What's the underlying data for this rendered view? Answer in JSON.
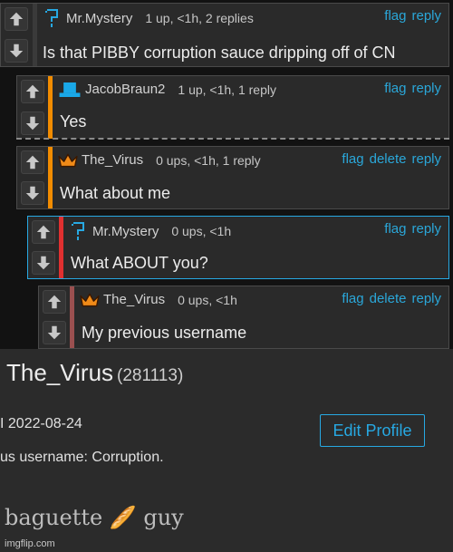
{
  "comments": [
    {
      "username": "Mr.Mystery",
      "meta": "1 up, <1h, 2 replies",
      "text": "Is that PIBBY corruption sauce dripping off of CN",
      "actions": [
        "flag",
        "reply"
      ]
    },
    {
      "username": "JacobBraun2",
      "meta": "1 up, <1h, 1 reply",
      "text": "Yes",
      "actions": [
        "flag",
        "reply"
      ]
    },
    {
      "username": "The_Virus",
      "meta": "0 ups, <1h, 1 reply",
      "text": "What about me",
      "actions": [
        "flag",
        "delete",
        "reply"
      ]
    },
    {
      "username": "Mr.Mystery",
      "meta": "0 ups, <1h",
      "text": "What ABOUT you?",
      "actions": [
        "flag",
        "reply"
      ]
    },
    {
      "username": "The_Virus",
      "meta": "0 ups, <1h",
      "text": "My previous username",
      "actions": [
        "flag",
        "delete",
        "reply"
      ]
    }
  ],
  "profile": {
    "username": "The_Virus",
    "user_id": "(281113)",
    "joined": "I 2022-08-24",
    "previous": "us username: Corruption.",
    "bio": "baguette 🥖 guy",
    "edit_label": "Edit Profile"
  },
  "watermark": "imgflip.com",
  "colors": {
    "accent": "#27a9e3",
    "thread_orange": "#f28c00",
    "thread_red": "#e03030",
    "thread_brown": "#9b5050"
  },
  "icons": [
    "arrow-up-icon",
    "arrow-down-icon",
    "pixel-question-avatar-icon",
    "top-hat-avatar-icon",
    "crown-avatar-icon"
  ]
}
